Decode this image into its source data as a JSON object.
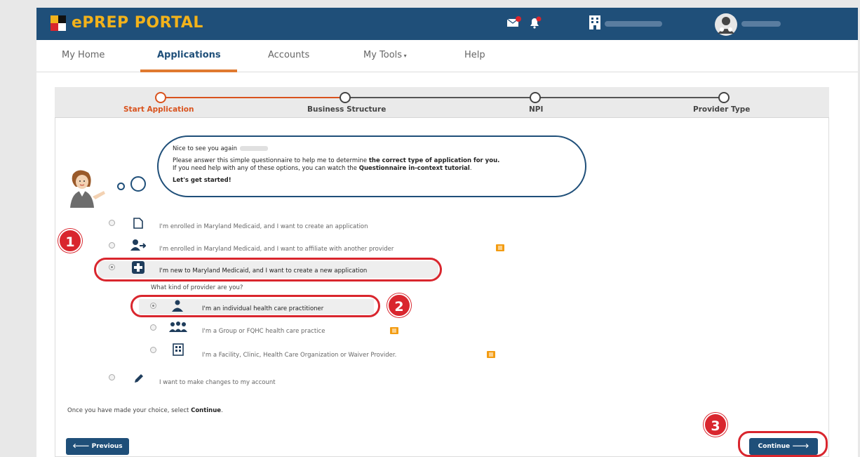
{
  "header": {
    "brand_name": "ePREP PORTAL",
    "colors": {
      "bar": "#1f4f79",
      "brand_text": "#f2b21b",
      "accent": "#e07a30",
      "annotation": "#d9262e"
    },
    "icons": [
      "mail-icon",
      "bell-icon",
      "building-icon",
      "user-avatar-icon"
    ]
  },
  "nav": {
    "items": [
      {
        "label": "My Home"
      },
      {
        "label": "Applications"
      },
      {
        "label": "Accounts"
      },
      {
        "label": "My Tools"
      },
      {
        "label": "Help"
      }
    ],
    "active": "Applications"
  },
  "stepper": {
    "steps": [
      {
        "label": "Start Application",
        "active": true
      },
      {
        "label": "Business Structure",
        "active": false
      },
      {
        "label": "NPI",
        "active": false
      },
      {
        "label": "Provider Type",
        "active": false
      }
    ]
  },
  "bubble": {
    "greeting": "Nice to see you again",
    "line1_prefix": "Please answer this simple questionnaire to help me to determine ",
    "line1_bold": "the correct type of application for you.",
    "line2_prefix": "If you need help with any of these options, you can watch the ",
    "line2_bold": "Questionnaire in-context tutorial",
    "line2_suffix": ".",
    "line3": "Let's get started!"
  },
  "options": {
    "enrolled_create": "I'm enrolled in Maryland Medicaid, and I want to create an application",
    "enrolled_affiliate": "I'm enrolled in Maryland Medicaid, and I want to affiliate with another provider",
    "new_create": "I'm new to Maryland Medicaid, and I want to create a new application",
    "question": "What kind of provider are you?",
    "individual": "I'm an individual health care practitioner",
    "group": "I'm a Group or FQHC health care practice",
    "facility": "I'm a Facility, Clinic, Health Care Organization or Waiver Provider.",
    "changes": "I want to make changes to my account"
  },
  "footnote": {
    "prefix": "Once you have made your choice, select ",
    "bold": "Continue",
    "suffix": "."
  },
  "buttons": {
    "previous": "Previous",
    "continue": "Continue"
  },
  "annotations": [
    "1",
    "2",
    "3"
  ]
}
